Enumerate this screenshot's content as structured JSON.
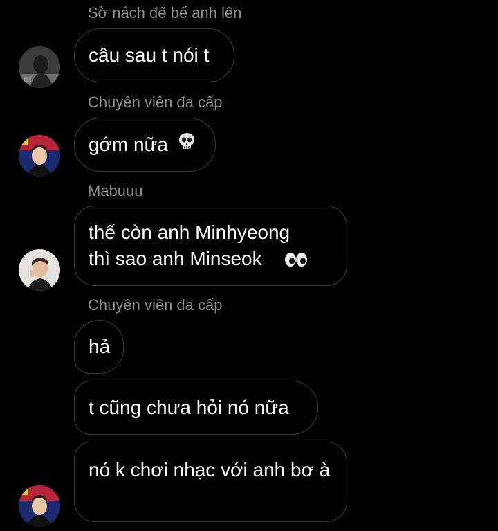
{
  "messages": [
    {
      "sender": "Sờ nách để bế anh lên",
      "bubbles": [
        "câu sau t nói t"
      ],
      "avatar": "avatar-dark-hair"
    },
    {
      "sender": "Chuyên viên đa cấp",
      "bubbles": [
        "gớm nữa"
      ],
      "emoji": "skull-icon",
      "avatar": "avatar-red-stage"
    },
    {
      "sender": "Mabuuu",
      "bubbles": [
        "thế còn anh Minhyeong\nthì sao anh Minseok"
      ],
      "emoji": "eyes-icon",
      "avatar": "avatar-light-bg"
    },
    {
      "sender": "Chuyên viên đa cấp",
      "bubbles": [
        "hả",
        "t cũng chưa hỏi nó nữa",
        "nó k chơi nhạc với anh bơ à"
      ],
      "avatar": "avatar-red-stage"
    }
  ],
  "colors": {
    "background": "#000000",
    "bubble_border": "#3a3a3a",
    "sender_name": "#8e8e8e",
    "text": "#ffffff"
  }
}
